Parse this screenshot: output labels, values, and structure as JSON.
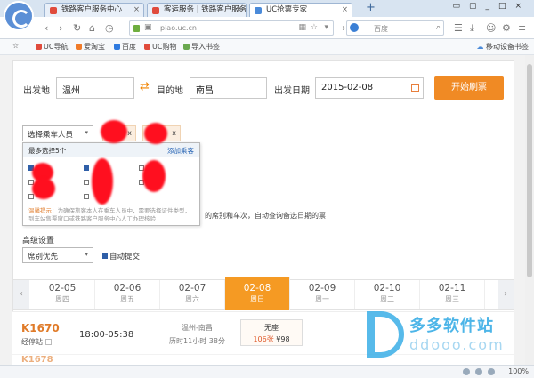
{
  "browser": {
    "tabs": [
      {
        "label": "铁路客户服务中心"
      },
      {
        "label": "客运服务 | 铁路客户服务中心"
      },
      {
        "label": "UC抢票专家"
      }
    ],
    "tab_close": "×",
    "new_tab": "+",
    "url": "piao.uc.cn",
    "search_placeholder": "百度",
    "bookmarks": [
      {
        "label": "UC导航",
        "color": "#e04b3c"
      },
      {
        "label": "爱淘宝",
        "color": "#f07b2a"
      },
      {
        "label": "百度",
        "color": "#2f7be0"
      },
      {
        "label": "UC购物",
        "color": "#e04b3c"
      },
      {
        "label": "导入书签",
        "color": "#6aa84f"
      }
    ],
    "bookmarks_right": "移动设备书签"
  },
  "form": {
    "from_label": "出发地",
    "from_value": "温州",
    "to_label": "目的地",
    "to_value": "南昌",
    "date_label": "出发日期",
    "date_value": "2015-02-08",
    "submit_label": "开始刷票",
    "passenger_select": "选择乘车人员",
    "chip_close": "x",
    "dropdown_header": "最多选择5个",
    "dropdown_add": "添加乘客",
    "warning_title": "温馨提示：",
    "warning_text": "为确保旅客本人在乘车人员中，需要选择证件类型，到车站售票窗口或铁路客户服务中心人工办理核验",
    "hint_text": "的席别和车次，自动查询备选日期的票",
    "advanced_label": "高级设置",
    "seat_priority": "席别优先",
    "auto_submit": "自动提交"
  },
  "dates": [
    {
      "date": "02-05",
      "weekday": "周四"
    },
    {
      "date": "02-06",
      "weekday": "周五"
    },
    {
      "date": "02-07",
      "weekday": "周六"
    },
    {
      "date": "02-08",
      "weekday": "周日",
      "active": true
    },
    {
      "date": "02-09",
      "weekday": "周一"
    },
    {
      "date": "02-10",
      "weekday": "周二"
    },
    {
      "date": "02-11",
      "weekday": "周三"
    }
  ],
  "date_prev": "‹",
  "date_next": "›",
  "train": {
    "number": "K1670",
    "via_label": "经停站",
    "time": "18:00-05:38",
    "stations": "温州-南昌",
    "duration": "历时11小时 38分",
    "seat_name": "无座",
    "seat_count": "106张",
    "seat_price": "¥98"
  },
  "next_train_partial": "K1678",
  "watermark": {
    "name": "多多软件站",
    "site": "ddooo.com"
  },
  "status": {
    "zoom": "100%"
  }
}
